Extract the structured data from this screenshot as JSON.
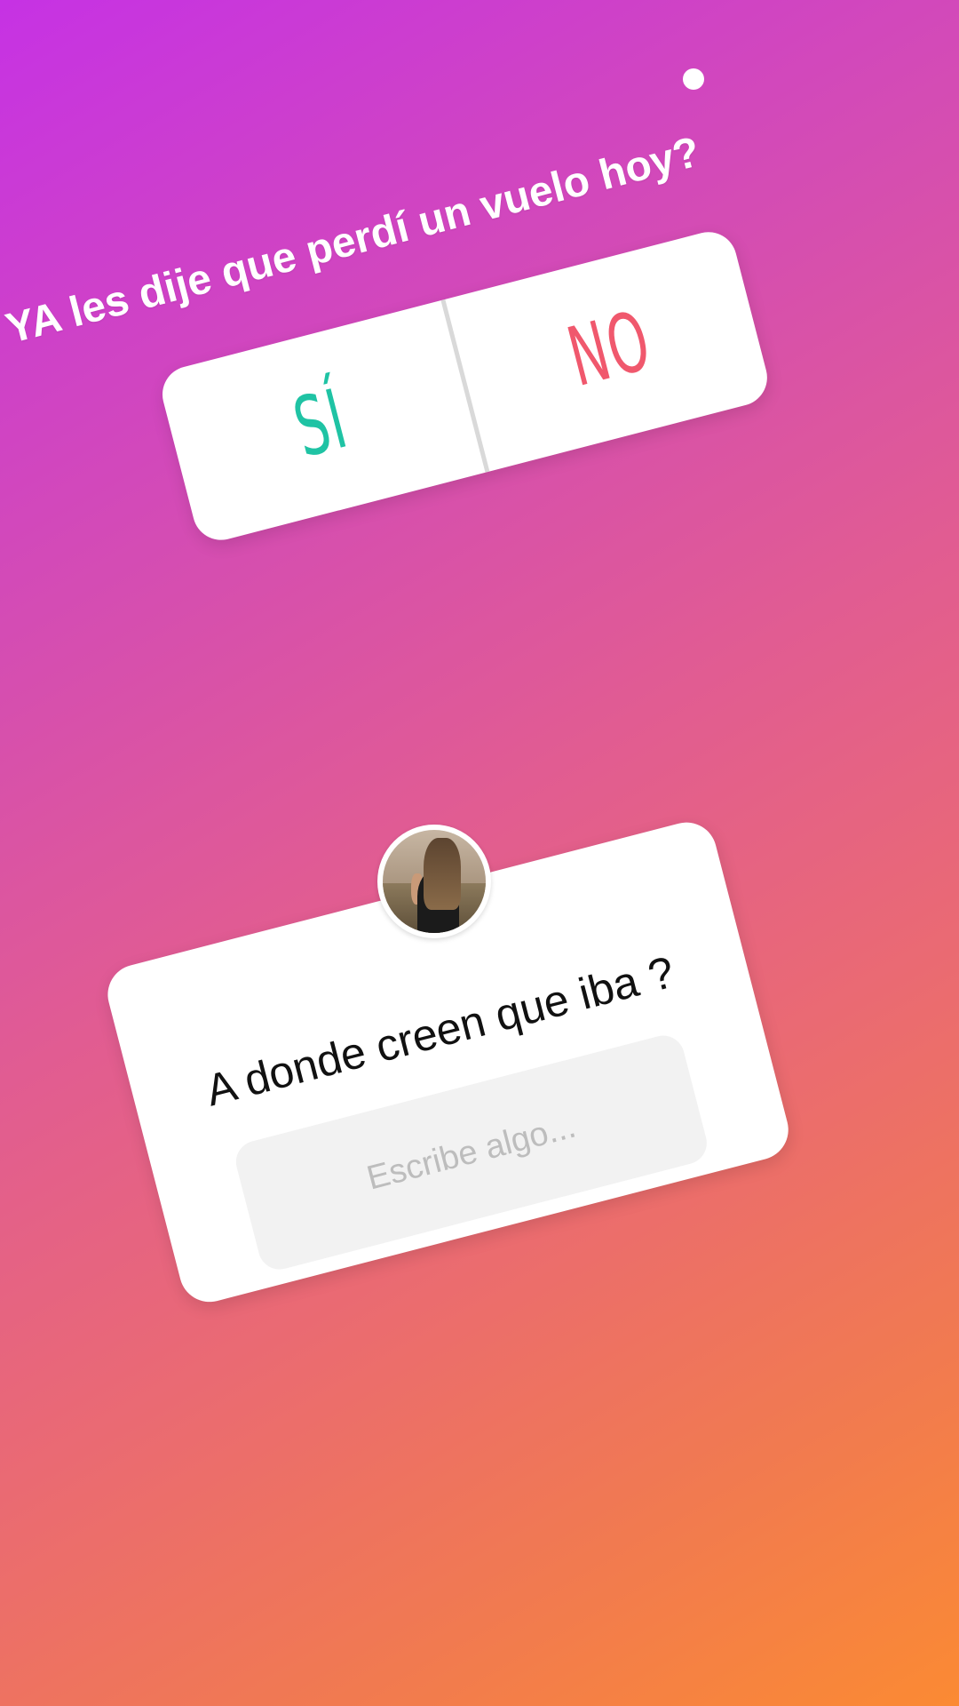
{
  "story": {
    "background_gradient": [
      "#c632e4",
      "#e15c92",
      "#fb8a33"
    ]
  },
  "poll": {
    "question": "YA les dije que perdí un vuelo hoy?",
    "options": [
      {
        "label": "SÍ",
        "color": "#1fc3a4"
      },
      {
        "label": "NO",
        "color": "#f0586d"
      }
    ]
  },
  "question_sticker": {
    "avatar_icon": "profile-photo",
    "prompt": "A donde creen que iba ?",
    "input": {
      "placeholder": "Escribe algo...",
      "value": ""
    }
  }
}
